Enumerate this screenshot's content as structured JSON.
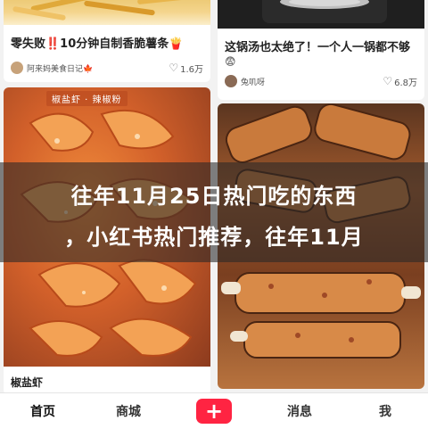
{
  "feed": {
    "cards": [
      {
        "title": "零失败‼️10分钟自制香脆薯条🍟",
        "author": "阿来妈美食日记🍁",
        "likes": "1.6万"
      },
      {
        "title": "这锅汤也太绝了！一个人一锅都不够",
        "author": "兔叽呀",
        "likes": "6.8万"
      },
      {
        "title": "椒盐虾",
        "photo_tag": "椒盐虾 · 辣椒粉"
      },
      {
        "title": ""
      }
    ]
  },
  "overlay": {
    "line1": "往年11月25日热门吃的东西",
    "line2": "，小红书热门推荐，往年11月"
  },
  "tabbar": {
    "home": "首页",
    "shop": "商城",
    "plus": "+",
    "messages": "消息",
    "me": "我"
  },
  "colors": {
    "accent": "#ff2442",
    "background": "#f2f2f2"
  },
  "icons": [
    "heart-icon",
    "plus-icon"
  ]
}
